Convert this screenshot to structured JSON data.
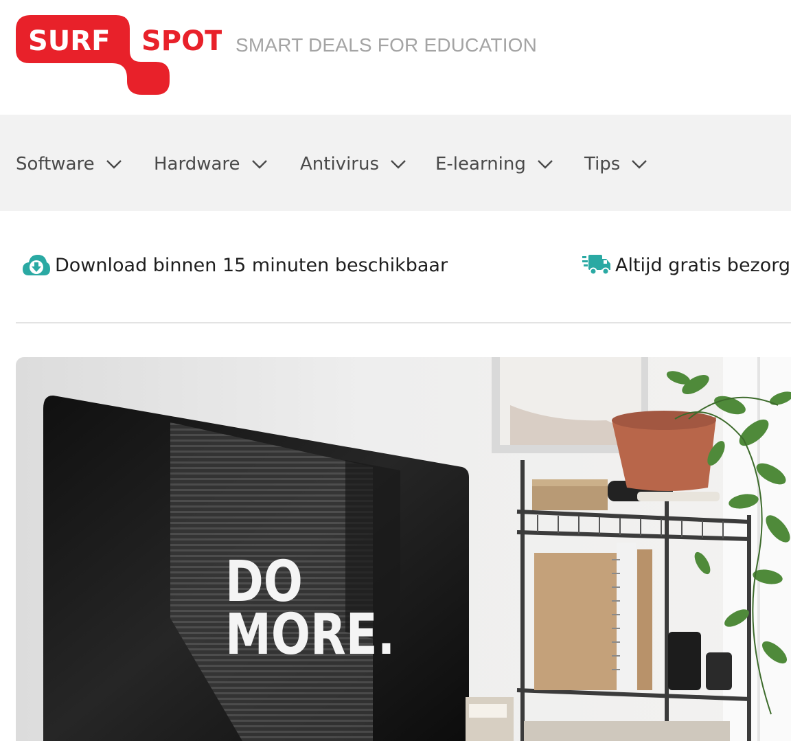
{
  "brand": {
    "logo_word_1": "SURF",
    "logo_word_2": "SPOT",
    "tagline": "SMART DEALS FOR EDUCATION",
    "color_primary": "#e8212a"
  },
  "nav": {
    "items": [
      {
        "label": "Software"
      },
      {
        "label": "Hardware"
      },
      {
        "label": "Antivirus"
      },
      {
        "label": "E-learning"
      },
      {
        "label": "Tips"
      }
    ],
    "icon": "chevron-down-icon"
  },
  "usps": [
    {
      "text": "Download binnen 15 minuten beschikbaar",
      "icon": "cloud-download-icon",
      "color": "#2aa9a3"
    },
    {
      "text": "Altijd gratis bezorg",
      "icon": "delivery-truck-icon",
      "color": "#2aa9a3"
    }
  ],
  "hero": {
    "screen_text_line_1": "DO",
    "screen_text_line_2": "MORE."
  }
}
